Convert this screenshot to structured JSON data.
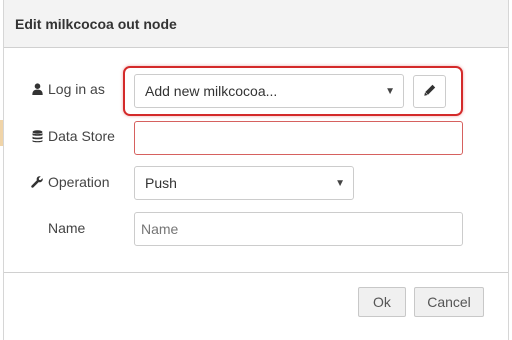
{
  "dialog": {
    "title": "Edit milkcocoa out node"
  },
  "form": {
    "login": {
      "label": "Log in as",
      "icon": "user-icon",
      "selected": "Add new milkcocoa...",
      "edit_icon": "pencil-icon"
    },
    "datastore": {
      "label": "Data Store",
      "icon": "database-icon",
      "value": ""
    },
    "operation": {
      "label": "Operation",
      "icon": "wrench-icon",
      "selected": "Push"
    },
    "name": {
      "label": "Name",
      "placeholder": "Name",
      "value": ""
    }
  },
  "footer": {
    "ok_label": "Ok",
    "cancel_label": "Cancel"
  },
  "colors": {
    "highlight": "#d42a2a",
    "error_border": "#d6615f"
  }
}
